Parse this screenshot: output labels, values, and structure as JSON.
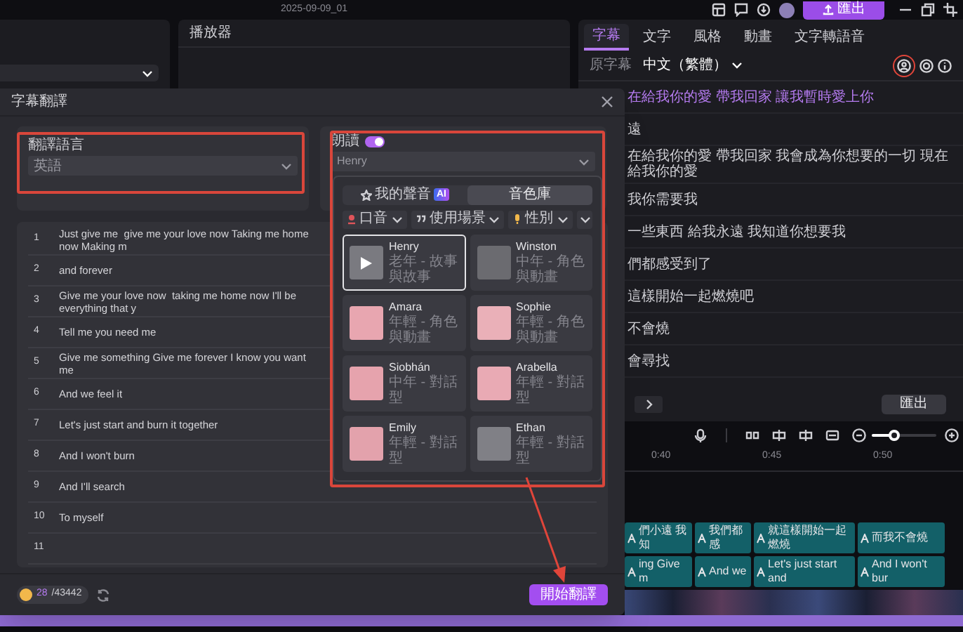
{
  "top_bar": {
    "title": "2025-09-09_01",
    "export_button": "匯出"
  },
  "player": {
    "title": "播放器"
  },
  "right_panel": {
    "tabs": [
      {
        "label": "字幕",
        "selected": true
      },
      {
        "label": "文字",
        "selected": false
      },
      {
        "label": "風格",
        "selected": false
      },
      {
        "label": "動畫",
        "selected": false
      },
      {
        "label": "文字轉語音",
        "selected": false
      }
    ],
    "source_label": "原字幕",
    "language": "中文（繁體）",
    "subtitles": [
      {
        "text": "在給我你的愛 帶我回家 讓我暫時愛上你",
        "selected": true
      },
      {
        "text": "遠",
        "selected": false
      },
      {
        "text": "在給我你的愛 帶我回家 我會成為你想要的一切 現在給我你的愛",
        "selected": false
      },
      {
        "text": "我你需要我",
        "selected": false
      },
      {
        "text": "一些東西 給我永遠 我知道你想要我",
        "selected": false
      },
      {
        "text": "們都感受到了",
        "selected": false
      },
      {
        "text": "這樣開始一起燃燒吧",
        "selected": false
      },
      {
        "text": "不會燒",
        "selected": false
      },
      {
        "text": "會尋找",
        "selected": false
      }
    ],
    "export_button": "匯出"
  },
  "timeline": {
    "ruler": [
      "0:40",
      "0:45",
      "0:50"
    ],
    "zoom": {
      "level": 0.35
    },
    "tracks": [
      {
        "clips": [
          "們小遠 我知",
          "我們都感",
          "就這樣開始一起燃燒",
          "而我不會燒"
        ]
      },
      {
        "clips": [
          "ing Give m",
          "And we",
          "Let's just start and",
          "And I won't bur"
        ]
      }
    ]
  },
  "dialog": {
    "title": "字幕翻譯",
    "language": {
      "label": "翻譯語言",
      "value": "英語"
    },
    "read_aloud": {
      "label": "朗讀",
      "on": true,
      "value": "Henry"
    },
    "voice_tabs": [
      {
        "label": "我的聲音",
        "badge": "AI",
        "selected": false
      },
      {
        "label": "音色庫",
        "selected": true
      }
    ],
    "filters": [
      "口音",
      "使用場景",
      "性別"
    ],
    "voices": [
      {
        "name": "Henry",
        "description": "老年 - 故事與故事",
        "selected": true
      },
      {
        "name": "Winston",
        "description": "中年 - 角色與動畫",
        "selected": false
      },
      {
        "name": "Amara",
        "description": "年輕 - 角色與動畫",
        "selected": false
      },
      {
        "name": "Sophie",
        "description": "年輕 - 角色與動畫",
        "selected": false
      },
      {
        "name": "Siobhán",
        "description": "中年 - 對話型",
        "selected": false
      },
      {
        "name": "Arabella",
        "description": "年輕 - 對話型",
        "selected": false
      },
      {
        "name": "Emily",
        "description": "年輕 - 對話型",
        "selected": false
      },
      {
        "name": "Ethan",
        "description": "年輕 - 對話型",
        "selected": false
      }
    ],
    "lines": [
      {
        "number": "1",
        "text": "Just give me  give me your love now Taking me home now Making m"
      },
      {
        "number": "2",
        "text": "and forever"
      },
      {
        "number": "3",
        "text": "Give me your love now  taking me home now I'll be everything that y"
      },
      {
        "number": "4",
        "text": "Tell me you need me"
      },
      {
        "number": "5",
        "text": "Give me something Give me forever I know you want me"
      },
      {
        "number": "6",
        "text": "And we feel it"
      },
      {
        "number": "7",
        "text": "Let's just start and burn it together"
      },
      {
        "number": "8",
        "text": "And I won't burn"
      },
      {
        "number": "9",
        "text": "And I'll search"
      },
      {
        "number": "10",
        "text": "To myself"
      },
      {
        "number": "11"
      }
    ],
    "credits": {
      "used": "28",
      "total": "/43442"
    },
    "start_button": "開始翻譯"
  }
}
